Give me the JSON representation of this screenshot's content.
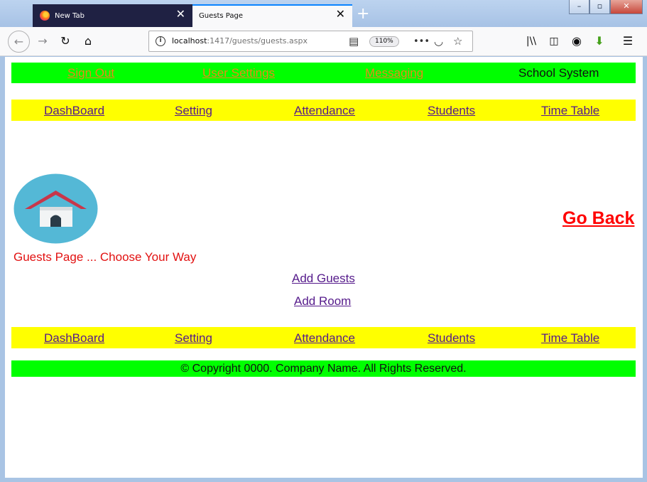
{
  "browser": {
    "tabs": [
      {
        "label": "New Tab"
      },
      {
        "label": "Guests Page"
      }
    ],
    "url_host": "localhost",
    "url_path": ":1417/guests/guests.aspx",
    "zoom": "110%"
  },
  "topnav": {
    "sign_out": "Sign Out",
    "user_settings": "User Settings",
    "messaging": "Messaging",
    "brand": "School System"
  },
  "menu": [
    "DashBoard",
    "Setting",
    "Attendance",
    "Students",
    "Time Table"
  ],
  "main": {
    "go_back": "Go Back",
    "subtitle": "Guests Page ... Choose Your Way",
    "add_guests": "Add Guests",
    "add_room": "Add Room"
  },
  "footer": {
    "copyright": "© Copyright 0000. Company Name. All Rights Reserved."
  },
  "colors": {
    "topbar_bg": "#00ff00",
    "menubar_bg": "#ffff00",
    "accent_red": "#ff0000",
    "nav_orange": "#e88a17"
  },
  "icons": {
    "home_logo": "home-icon"
  }
}
